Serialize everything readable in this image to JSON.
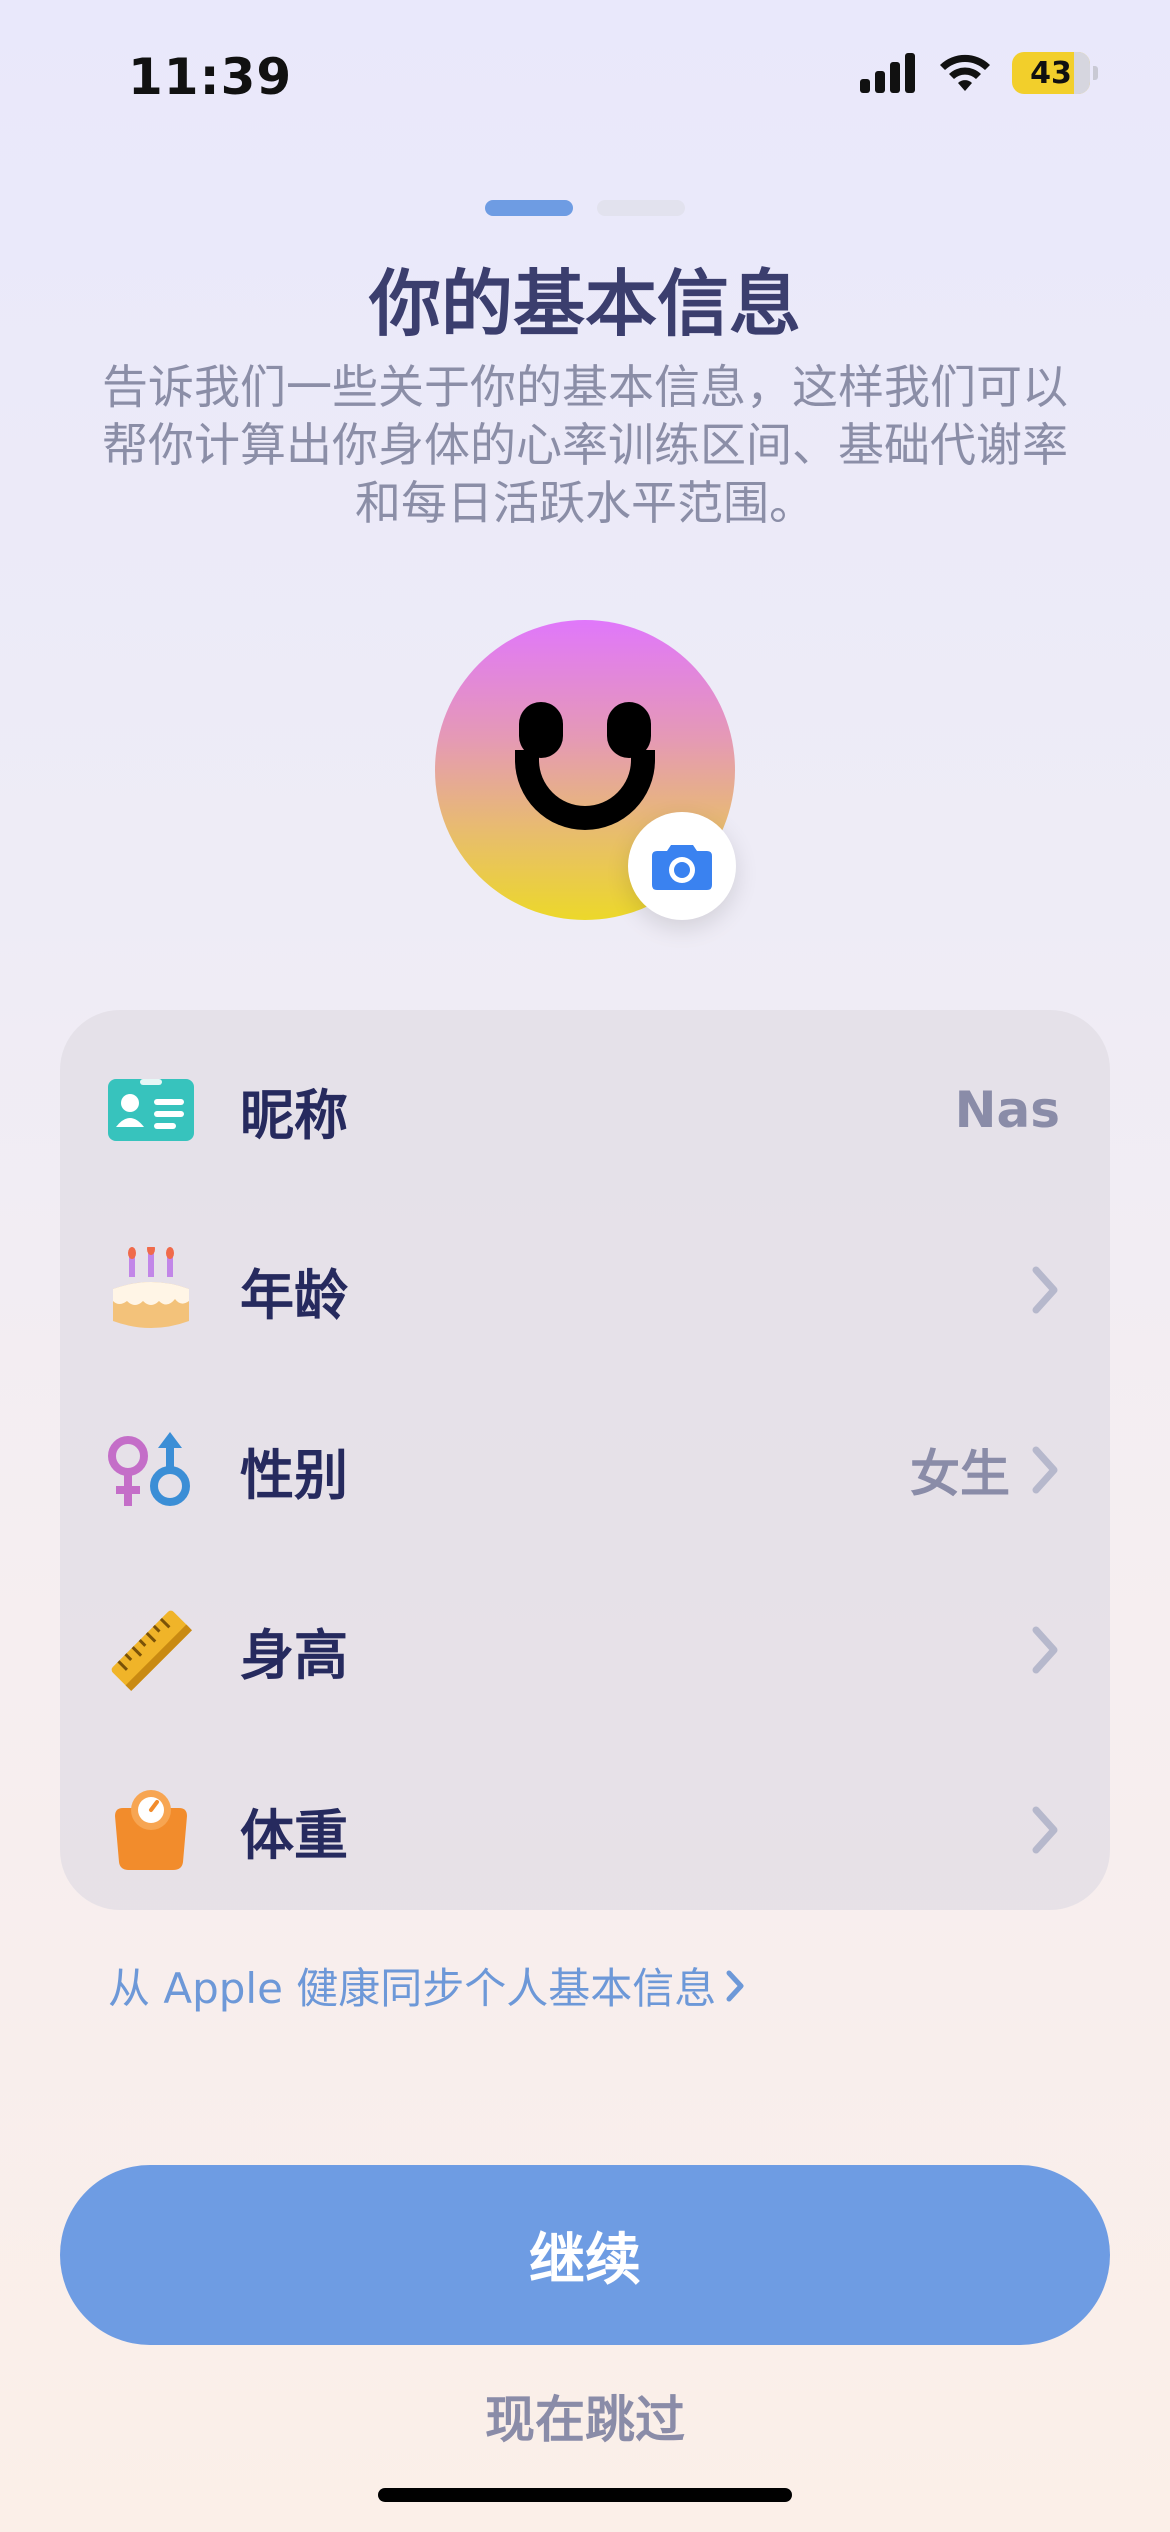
{
  "status_bar": {
    "time": "11:39",
    "battery": "43"
  },
  "page": {
    "title": "你的基本信息",
    "subtitle": "告诉我们一些关于你的基本信息，这样我们可以帮你计算出你身体的心率训练区间、基础代谢率和每日活跃水平范围。",
    "pager": {
      "pages": 2,
      "active": 1
    }
  },
  "avatar": {
    "face_icon": "smiley-face-icon",
    "camera_icon": "camera-icon"
  },
  "profile": {
    "rows": [
      {
        "label": "昵称",
        "value": "Nas",
        "icon": "id-card-icon",
        "chevron": false
      },
      {
        "label": "年龄",
        "value": "",
        "icon": "birthday-cake-icon",
        "chevron": true
      },
      {
        "label": "性别",
        "value": "女生",
        "icon": "gender-icon",
        "chevron": true
      },
      {
        "label": "身高",
        "value": "",
        "icon": "ruler-icon",
        "chevron": true
      },
      {
        "label": "体重",
        "value": "",
        "icon": "weight-scale-icon",
        "chevron": true
      }
    ]
  },
  "sync": {
    "label": "从 Apple 健康同步个人基本信息"
  },
  "actions": {
    "continue": "继续",
    "skip": "现在跳过"
  },
  "colors": {
    "accent": "#6e9ce3",
    "title": "#3b3e6e",
    "label": "#262a5e",
    "muted": "#8a8ca8"
  }
}
